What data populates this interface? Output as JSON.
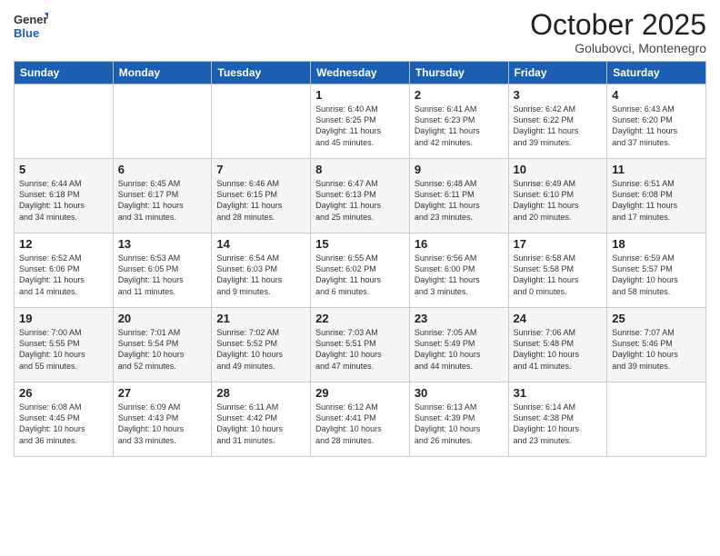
{
  "logo": {
    "general": "General",
    "blue": "Blue"
  },
  "header": {
    "month": "October 2025",
    "location": "Golubovci, Montenegro"
  },
  "days_of_week": [
    "Sunday",
    "Monday",
    "Tuesday",
    "Wednesday",
    "Thursday",
    "Friday",
    "Saturday"
  ],
  "weeks": [
    [
      {
        "day": "",
        "info": ""
      },
      {
        "day": "",
        "info": ""
      },
      {
        "day": "",
        "info": ""
      },
      {
        "day": "1",
        "info": "Sunrise: 6:40 AM\nSunset: 6:25 PM\nDaylight: 11 hours\nand 45 minutes."
      },
      {
        "day": "2",
        "info": "Sunrise: 6:41 AM\nSunset: 6:23 PM\nDaylight: 11 hours\nand 42 minutes."
      },
      {
        "day": "3",
        "info": "Sunrise: 6:42 AM\nSunset: 6:22 PM\nDaylight: 11 hours\nand 39 minutes."
      },
      {
        "day": "4",
        "info": "Sunrise: 6:43 AM\nSunset: 6:20 PM\nDaylight: 11 hours\nand 37 minutes."
      }
    ],
    [
      {
        "day": "5",
        "info": "Sunrise: 6:44 AM\nSunset: 6:18 PM\nDaylight: 11 hours\nand 34 minutes."
      },
      {
        "day": "6",
        "info": "Sunrise: 6:45 AM\nSunset: 6:17 PM\nDaylight: 11 hours\nand 31 minutes."
      },
      {
        "day": "7",
        "info": "Sunrise: 6:46 AM\nSunset: 6:15 PM\nDaylight: 11 hours\nand 28 minutes."
      },
      {
        "day": "8",
        "info": "Sunrise: 6:47 AM\nSunset: 6:13 PM\nDaylight: 11 hours\nand 25 minutes."
      },
      {
        "day": "9",
        "info": "Sunrise: 6:48 AM\nSunset: 6:11 PM\nDaylight: 11 hours\nand 23 minutes."
      },
      {
        "day": "10",
        "info": "Sunrise: 6:49 AM\nSunset: 6:10 PM\nDaylight: 11 hours\nand 20 minutes."
      },
      {
        "day": "11",
        "info": "Sunrise: 6:51 AM\nSunset: 6:08 PM\nDaylight: 11 hours\nand 17 minutes."
      }
    ],
    [
      {
        "day": "12",
        "info": "Sunrise: 6:52 AM\nSunset: 6:06 PM\nDaylight: 11 hours\nand 14 minutes."
      },
      {
        "day": "13",
        "info": "Sunrise: 6:53 AM\nSunset: 6:05 PM\nDaylight: 11 hours\nand 11 minutes."
      },
      {
        "day": "14",
        "info": "Sunrise: 6:54 AM\nSunset: 6:03 PM\nDaylight: 11 hours\nand 9 minutes."
      },
      {
        "day": "15",
        "info": "Sunrise: 6:55 AM\nSunset: 6:02 PM\nDaylight: 11 hours\nand 6 minutes."
      },
      {
        "day": "16",
        "info": "Sunrise: 6:56 AM\nSunset: 6:00 PM\nDaylight: 11 hours\nand 3 minutes."
      },
      {
        "day": "17",
        "info": "Sunrise: 6:58 AM\nSunset: 5:58 PM\nDaylight: 11 hours\nand 0 minutes."
      },
      {
        "day": "18",
        "info": "Sunrise: 6:59 AM\nSunset: 5:57 PM\nDaylight: 10 hours\nand 58 minutes."
      }
    ],
    [
      {
        "day": "19",
        "info": "Sunrise: 7:00 AM\nSunset: 5:55 PM\nDaylight: 10 hours\nand 55 minutes."
      },
      {
        "day": "20",
        "info": "Sunrise: 7:01 AM\nSunset: 5:54 PM\nDaylight: 10 hours\nand 52 minutes."
      },
      {
        "day": "21",
        "info": "Sunrise: 7:02 AM\nSunset: 5:52 PM\nDaylight: 10 hours\nand 49 minutes."
      },
      {
        "day": "22",
        "info": "Sunrise: 7:03 AM\nSunset: 5:51 PM\nDaylight: 10 hours\nand 47 minutes."
      },
      {
        "day": "23",
        "info": "Sunrise: 7:05 AM\nSunset: 5:49 PM\nDaylight: 10 hours\nand 44 minutes."
      },
      {
        "day": "24",
        "info": "Sunrise: 7:06 AM\nSunset: 5:48 PM\nDaylight: 10 hours\nand 41 minutes."
      },
      {
        "day": "25",
        "info": "Sunrise: 7:07 AM\nSunset: 5:46 PM\nDaylight: 10 hours\nand 39 minutes."
      }
    ],
    [
      {
        "day": "26",
        "info": "Sunrise: 6:08 AM\nSunset: 4:45 PM\nDaylight: 10 hours\nand 36 minutes."
      },
      {
        "day": "27",
        "info": "Sunrise: 6:09 AM\nSunset: 4:43 PM\nDaylight: 10 hours\nand 33 minutes."
      },
      {
        "day": "28",
        "info": "Sunrise: 6:11 AM\nSunset: 4:42 PM\nDaylight: 10 hours\nand 31 minutes."
      },
      {
        "day": "29",
        "info": "Sunrise: 6:12 AM\nSunset: 4:41 PM\nDaylight: 10 hours\nand 28 minutes."
      },
      {
        "day": "30",
        "info": "Sunrise: 6:13 AM\nSunset: 4:39 PM\nDaylight: 10 hours\nand 26 minutes."
      },
      {
        "day": "31",
        "info": "Sunrise: 6:14 AM\nSunset: 4:38 PM\nDaylight: 10 hours\nand 23 minutes."
      },
      {
        "day": "",
        "info": ""
      }
    ]
  ]
}
